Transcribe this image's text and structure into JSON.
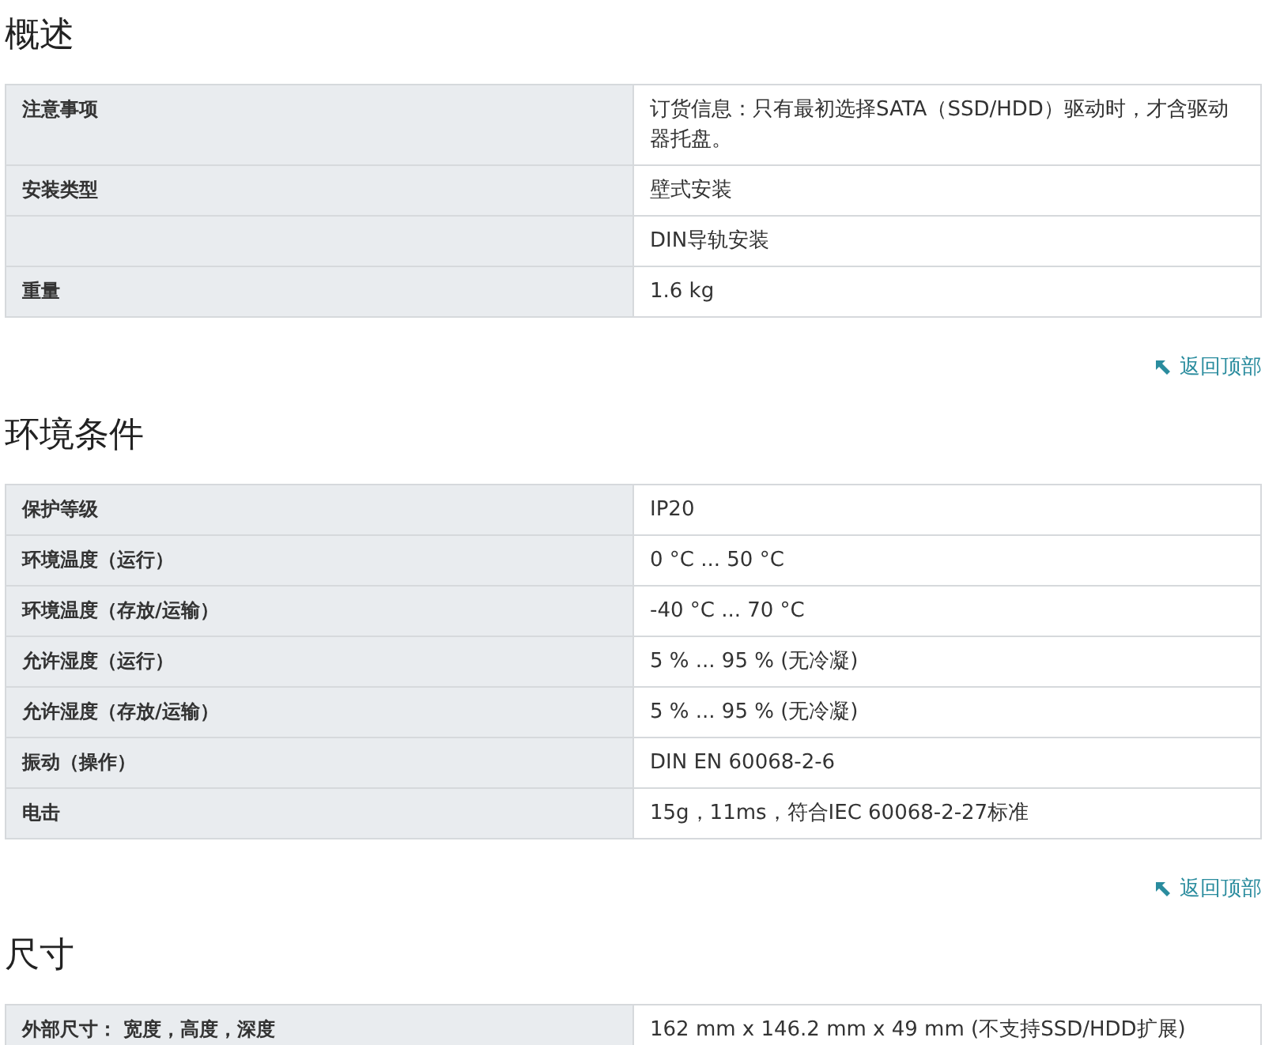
{
  "sections": [
    {
      "title": "概述",
      "rows": [
        {
          "label": "注意事项",
          "value": "订货信息：只有最初选择SATA（SSD/HDD）驱动时，才含驱动器托盘。"
        },
        {
          "label": "安装类型",
          "value": "壁式安装"
        },
        {
          "value": "DIN导轨安装"
        },
        {
          "label": "重量",
          "value": "1.6 kg"
        }
      ],
      "back_to_top": "返回顶部"
    },
    {
      "title": "环境条件",
      "rows": [
        {
          "label": "保护等级",
          "value": "IP20"
        },
        {
          "label": "环境温度（运行）",
          "value": "0 °C ... 50 °C"
        },
        {
          "label": "环境温度（存放/运输）",
          "value": "-40 °C ... 70 °C"
        },
        {
          "label": "允许湿度（运行）",
          "value": "5 % ... 95 % (无冷凝)"
        },
        {
          "label": "允许湿度（存放/运输）",
          "value": "5 % ... 95 % (无冷凝)"
        },
        {
          "label": "振动（操作）",
          "value": "DIN EN 60068-2-6"
        },
        {
          "label": "电击",
          "value": "15g，11ms，符合IEC 60068-2-27标准"
        }
      ],
      "back_to_top": "返回顶部"
    },
    {
      "title": "尺寸",
      "rows": [
        {
          "label": "外部尺寸： 宽度，高度，深度",
          "value": "162 mm x 146.2 mm x 49 mm (不支持SSD/HDD扩展)"
        }
      ]
    }
  ]
}
